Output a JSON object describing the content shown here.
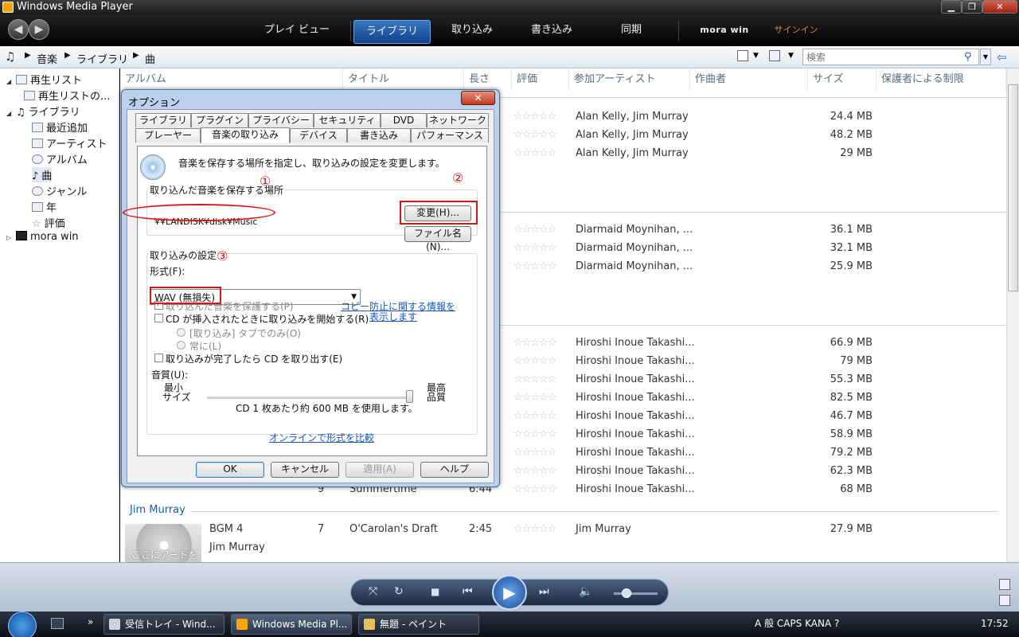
{
  "window": {
    "title": "Windows Media Player",
    "min": "▁",
    "max": "❐",
    "close": "✕"
  },
  "nav": {
    "back": "◀",
    "forward": "▶",
    "tabs": [
      "プレイ ビュー",
      "ライブラリ",
      "取り込み",
      "書き込み",
      "同期"
    ],
    "mora": "mora win",
    "signin": "サインイン"
  },
  "breadcrumb": [
    "音楽",
    "ライブラリ",
    "曲"
  ],
  "search": {
    "placeholder": "検索"
  },
  "tree": [
    {
      "label": "再生リスト",
      "indent": 0,
      "twisty": "◢"
    },
    {
      "label": "再生リストの...",
      "indent": 1,
      "twisty": ""
    },
    {
      "label": "ライブラリ",
      "indent": 0,
      "twisty": "◢"
    },
    {
      "label": "最近追加",
      "indent": 1,
      "twisty": ""
    },
    {
      "label": "アーティスト",
      "indent": 1,
      "twisty": ""
    },
    {
      "label": "アルバム",
      "indent": 1,
      "twisty": ""
    },
    {
      "label": "曲",
      "indent": 1,
      "twisty": ""
    },
    {
      "label": "ジャンル",
      "indent": 1,
      "twisty": ""
    },
    {
      "label": "年",
      "indent": 1,
      "twisty": ""
    },
    {
      "label": "評価",
      "indent": 1,
      "twisty": ""
    },
    {
      "label": "mora win",
      "indent": 0,
      "twisty": "▷"
    }
  ],
  "columns": [
    "アルバム",
    "タイトル",
    "長さ",
    "評価",
    "参加アーティスト",
    "作曲者",
    "サイズ",
    "保護者による制限"
  ],
  "rows": [
    {
      "artist": "Alan Kelly, Jim Murray",
      "size": "24.4 MB"
    },
    {
      "artist": "Alan Kelly, Jim Murray",
      "size": "48.2 MB"
    },
    {
      "artist": "Alan Kelly, Jim Murray",
      "size": "29 MB"
    },
    {
      "artist": "Diarmaid Moynihan, ...",
      "size": "36.1 MB"
    },
    {
      "artist": "Diarmaid Moynihan, ...",
      "size": "32.1 MB"
    },
    {
      "artist": "Diarmaid Moynihan, ...",
      "size": "25.9 MB"
    },
    {
      "artist": "Hiroshi Inoue Takashi...",
      "size": "66.9 MB"
    },
    {
      "artist": "Hiroshi Inoue Takashi...",
      "size": "79 MB"
    },
    {
      "artist": "Hiroshi Inoue Takashi...",
      "size": "55.3 MB"
    },
    {
      "artist": "Hiroshi Inoue Takashi...",
      "size": "82.5 MB"
    },
    {
      "artist": "Hiroshi Inoue Takashi...",
      "size": "46.7 MB"
    },
    {
      "artist": "Hiroshi Inoue Takashi...",
      "size": "58.9 MB"
    },
    {
      "artist": "Hiroshi Inoue Takashi...",
      "size": "79.2 MB"
    },
    {
      "artist": "Hiroshi Inoue Takashi...",
      "size": "62.3 MB"
    },
    {
      "artist": "Hiroshi Inoue Takashi...",
      "size": "68 MB",
      "track": "9",
      "title": "Summertime",
      "length": "6:44"
    }
  ],
  "group_jim": {
    "header": "Jim Murray",
    "album": "BGM 4",
    "album_artist": "Jim Murray",
    "art_text": "ここにアートを",
    "track": "7",
    "title": "O'Carolan's Draft",
    "length": "2:45",
    "artist": "Jim Murray",
    "size": "27.9 MB"
  },
  "rating_stars": "☆☆☆☆☆",
  "dialog": {
    "title": "オプション",
    "close": "✕",
    "tabs_top": [
      "ライブラリ",
      "プラグイン",
      "プライバシー",
      "セキュリティ",
      "DVD",
      "ネットワーク"
    ],
    "tabs_bottom": [
      "プレーヤー",
      "音楽の取り込み",
      "デバイス",
      "書き込み",
      "パフォーマンス"
    ],
    "intro": "音楽を保存する場所を指定し、取り込みの設定を変更します。",
    "save_location_label": "取り込んだ音楽を保存する場所",
    "path": "¥¥LANDISK¥disk¥Music",
    "change_button": "変更(H)...",
    "filename_button": "ファイル名(N)...",
    "rip_settings_label": "取り込みの設定",
    "format_label": "形式(F):",
    "format_value": "WAV (無損失)",
    "protect_label": "取り込んだ音楽を保護する(P)",
    "copy_link_1": "コピー防止に関する情報を",
    "copy_link_2": "表示します",
    "autorip_label": "CD が挿入されたときに取り込みを開始する(R)",
    "radio_tab_only": "[取り込み] タブでのみ(O)",
    "radio_always": "常に(L)",
    "eject_label": "取り込みが完了したら CD を取り出す(E)",
    "quality_label": "音質(U):",
    "min_size_1": "最小",
    "min_size_2": "サイズ",
    "max_quality_1": "最高",
    "max_quality_2": "品質",
    "usage_text": "CD 1 枚あたり約 600 MB を使用します。",
    "compare_link": "オンラインで形式を比較",
    "ok": "OK",
    "cancel": "キャンセル",
    "apply": "適用(A)",
    "help": "ヘルプ",
    "markers": [
      "①",
      "②",
      "③"
    ]
  },
  "player": {
    "shuffle": "⤧",
    "repeat": "↻",
    "stop": "■",
    "prev": "⏮",
    "play": "▶",
    "next": "⏭",
    "mute": "🔈"
  },
  "taskbar": {
    "items": [
      "受信トレイ - Wind...",
      "Windows Media Pl...",
      "無題 - ペイント"
    ],
    "tray": "A 般  CAPS KANA  ?",
    "clock": "17:52",
    "more": "»"
  },
  "colors": {
    "accent": "#1e5aa8",
    "red_annotation": "#d41818"
  }
}
